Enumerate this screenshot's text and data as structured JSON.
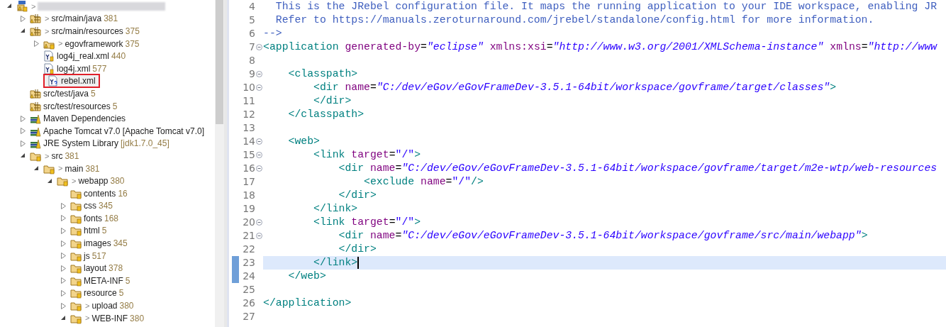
{
  "project_explorer": {
    "tree": [
      {
        "kind": "project",
        "decoration": ">",
        "expanded": true,
        "selected": false,
        "children": [
          {
            "kind": "source-folder",
            "decoration": ">",
            "label": "src/main/java",
            "count": "381",
            "expanded": false,
            "selected": false
          },
          {
            "kind": "source-folder",
            "decoration": ">",
            "label": "src/main/resources",
            "count": "375",
            "expanded": true,
            "selected": false,
            "children": [
              {
                "kind": "package",
                "decoration": ">",
                "label": "egovframework",
                "count": "375",
                "expanded": false,
                "selected": false
              },
              {
                "kind": "file",
                "label": "log4j_real.xml",
                "count": "440",
                "selected": false
              },
              {
                "kind": "file",
                "label": "log4j.xml",
                "count": "577",
                "selected": false
              },
              {
                "kind": "new-file",
                "label": "rebel.xml",
                "selected": true
              }
            ]
          },
          {
            "kind": "source-folder",
            "label": "src/test/java",
            "count": "5",
            "selected": false
          },
          {
            "kind": "source-folder",
            "label": "src/test/resources",
            "count": "5",
            "selected": false
          },
          {
            "kind": "library",
            "label": "Maven Dependencies",
            "expanded": false,
            "selected": false
          },
          {
            "kind": "library",
            "label": "Apache Tomcat v7.0 [Apache Tomcat v7.0]",
            "expanded": false,
            "selected": false
          },
          {
            "kind": "library",
            "label": "JRE System Library",
            "count": "[jdk1.7.0_45]",
            "expanded": false,
            "selected": false
          },
          {
            "kind": "folder",
            "decoration": ">",
            "label": "src",
            "count": "381",
            "expanded": true,
            "selected": false,
            "children": [
              {
                "kind": "folder",
                "decoration": ">",
                "label": "main",
                "count": "381",
                "expanded": true,
                "selected": false,
                "children": [
                  {
                    "kind": "folder",
                    "decoration": ">",
                    "label": "webapp",
                    "count": "380",
                    "expanded": true,
                    "selected": false,
                    "children": [
                      {
                        "kind": "folder",
                        "label": "contents",
                        "count": "16",
                        "selected": false
                      },
                      {
                        "kind": "folder",
                        "label": "css",
                        "count": "345",
                        "expanded": false,
                        "selected": false
                      },
                      {
                        "kind": "folder",
                        "label": "fonts",
                        "count": "168",
                        "expanded": false,
                        "selected": false
                      },
                      {
                        "kind": "folder",
                        "label": "html",
                        "count": "5",
                        "expanded": false,
                        "selected": false
                      },
                      {
                        "kind": "folder",
                        "label": "images",
                        "count": "345",
                        "expanded": false,
                        "selected": false
                      },
                      {
                        "kind": "folder",
                        "label": "js",
                        "count": "517",
                        "expanded": false,
                        "selected": false
                      },
                      {
                        "kind": "folder",
                        "label": "layout",
                        "count": "378",
                        "expanded": false,
                        "selected": false
                      },
                      {
                        "kind": "folder",
                        "label": "META-INF",
                        "count": "5",
                        "expanded": false,
                        "selected": false
                      },
                      {
                        "kind": "folder",
                        "label": "resource",
                        "count": "5",
                        "expanded": false,
                        "selected": false
                      },
                      {
                        "kind": "folder",
                        "decoration": ">",
                        "label": "upload",
                        "count": "380",
                        "expanded": false,
                        "selected": false
                      },
                      {
                        "kind": "folder",
                        "decoration": ">",
                        "label": "WEB-INF",
                        "count": "380",
                        "expanded": true,
                        "selected": false
                      }
                    ]
                  }
                ]
              }
            ]
          }
        ]
      }
    ]
  },
  "editor": {
    "lines": [
      {
        "number": "4",
        "fold": false,
        "changed": false,
        "current": false,
        "tokens": [
          {
            "kind": "comment",
            "text": "  This is the JRebel configuration file. It maps the running application to your IDE workspace, enabling JR"
          }
        ]
      },
      {
        "number": "5",
        "fold": false,
        "changed": false,
        "current": false,
        "tokens": [
          {
            "kind": "comment",
            "text": "  Refer to https://manuals.zeroturnaround.com/jrebel/standalone/config.html for more information."
          }
        ]
      },
      {
        "number": "6",
        "fold": false,
        "changed": false,
        "current": false,
        "tokens": [
          {
            "kind": "comment",
            "text": "-->"
          }
        ]
      },
      {
        "number": "7",
        "fold": true,
        "changed": false,
        "current": false,
        "tokens": [
          {
            "kind": "tag",
            "text": "<application"
          },
          {
            "kind": "attr",
            "text": " generated-by"
          },
          {
            "kind": "text",
            "text": "="
          },
          {
            "kind": "value",
            "text": "\"eclipse\""
          },
          {
            "kind": "attr",
            "text": " xmlns:xsi"
          },
          {
            "kind": "text",
            "text": "="
          },
          {
            "kind": "value",
            "text": "\"http://www.w3.org/2001/XMLSchema-instance\""
          },
          {
            "kind": "attr",
            "text": " xmlns"
          },
          {
            "kind": "text",
            "text": "="
          },
          {
            "kind": "value",
            "text": "\"http://www"
          }
        ]
      },
      {
        "number": "8",
        "fold": false,
        "changed": false,
        "current": false
      },
      {
        "number": "9",
        "fold": true,
        "changed": false,
        "current": false,
        "tokens": [
          {
            "kind": "tag",
            "text": "    <classpath>"
          }
        ]
      },
      {
        "number": "10",
        "fold": true,
        "changed": false,
        "current": false,
        "tokens": [
          {
            "kind": "tag",
            "text": "        <dir"
          },
          {
            "kind": "attr",
            "text": " name"
          },
          {
            "kind": "text",
            "text": "="
          },
          {
            "kind": "value",
            "text": "\"C:/dev/eGov/eGovFrameDev-3.5.1-64bit/workspace/govframe/target/classes\""
          },
          {
            "kind": "tag",
            "text": ">"
          }
        ]
      },
      {
        "number": "11",
        "fold": false,
        "changed": false,
        "current": false,
        "tokens": [
          {
            "kind": "tag",
            "text": "        </dir>"
          }
        ]
      },
      {
        "number": "12",
        "fold": false,
        "changed": false,
        "current": false,
        "tokens": [
          {
            "kind": "tag",
            "text": "    </classpath>"
          }
        ]
      },
      {
        "number": "13",
        "fold": false,
        "changed": false,
        "current": false
      },
      {
        "number": "14",
        "fold": true,
        "changed": false,
        "current": false,
        "tokens": [
          {
            "kind": "tag",
            "text": "    <web>"
          }
        ]
      },
      {
        "number": "15",
        "fold": true,
        "changed": false,
        "current": false,
        "tokens": [
          {
            "kind": "tag",
            "text": "        <link"
          },
          {
            "kind": "attr",
            "text": " target"
          },
          {
            "kind": "text",
            "text": "="
          },
          {
            "kind": "value-plain",
            "text": "\"/\""
          },
          {
            "kind": "tag",
            "text": ">"
          }
        ]
      },
      {
        "number": "16",
        "fold": true,
        "changed": false,
        "current": false,
        "tokens": [
          {
            "kind": "tag",
            "text": "            <dir"
          },
          {
            "kind": "attr",
            "text": " name"
          },
          {
            "kind": "text",
            "text": "="
          },
          {
            "kind": "value",
            "text": "\"C:/dev/eGov/eGovFrameDev-3.5.1-64bit/workspace/govframe/target/m2e-wtp/web-resources"
          }
        ]
      },
      {
        "number": "17",
        "fold": false,
        "changed": false,
        "current": false,
        "tokens": [
          {
            "kind": "tag",
            "text": "                <exclude"
          },
          {
            "kind": "attr",
            "text": " name"
          },
          {
            "kind": "text",
            "text": "="
          },
          {
            "kind": "value-plain",
            "text": "\"/\""
          },
          {
            "kind": "tag",
            "text": "/>"
          }
        ]
      },
      {
        "number": "18",
        "fold": false,
        "changed": false,
        "current": false,
        "tokens": [
          {
            "kind": "tag",
            "text": "            </dir>"
          }
        ]
      },
      {
        "number": "19",
        "fold": false,
        "changed": false,
        "current": false,
        "tokens": [
          {
            "kind": "tag",
            "text": "        </link>"
          }
        ]
      },
      {
        "number": "20",
        "fold": true,
        "changed": false,
        "current": false,
        "tokens": [
          {
            "kind": "tag",
            "text": "        <link"
          },
          {
            "kind": "attr",
            "text": " target"
          },
          {
            "kind": "text",
            "text": "="
          },
          {
            "kind": "value-plain",
            "text": "\"/\""
          },
          {
            "kind": "tag",
            "text": ">"
          }
        ]
      },
      {
        "number": "21",
        "fold": true,
        "changed": false,
        "current": false,
        "tokens": [
          {
            "kind": "tag",
            "text": "            <dir"
          },
          {
            "kind": "attr",
            "text": " name"
          },
          {
            "kind": "text",
            "text": "="
          },
          {
            "kind": "value",
            "text": "\"C:/dev/eGov/eGovFrameDev-3.5.1-64bit/workspace/govframe/src/main/webapp\""
          },
          {
            "kind": "tag",
            "text": ">"
          }
        ]
      },
      {
        "number": "22",
        "fold": false,
        "changed": false,
        "current": false,
        "tokens": [
          {
            "kind": "tag",
            "text": "            </dir>"
          }
        ]
      },
      {
        "number": "23",
        "fold": false,
        "changed": true,
        "current": true,
        "tokens": [
          {
            "kind": "tag",
            "text": "        </link>"
          }
        ]
      },
      {
        "number": "24",
        "fold": false,
        "changed": true,
        "current": false,
        "tokens": [
          {
            "kind": "tag",
            "text": "    </web>"
          }
        ]
      },
      {
        "number": "25",
        "fold": false,
        "changed": false,
        "current": false
      },
      {
        "number": "26",
        "fold": false,
        "changed": false,
        "current": false,
        "tokens": [
          {
            "kind": "tag",
            "text": "</application>"
          }
        ]
      },
      {
        "number": "27",
        "fold": false,
        "changed": false,
        "current": false
      }
    ]
  }
}
